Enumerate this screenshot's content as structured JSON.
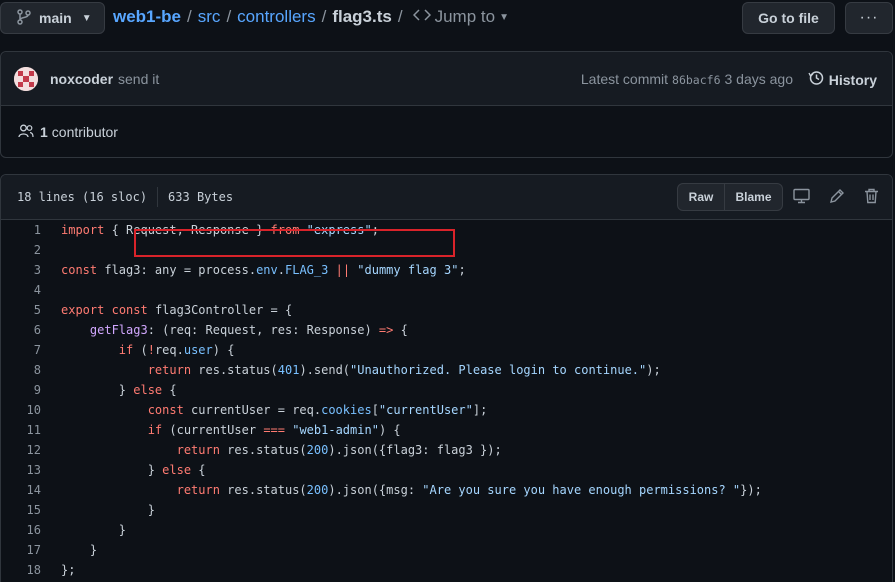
{
  "topbar": {
    "branch": "main",
    "breadcrumbs": [
      {
        "label": "web1-be"
      },
      {
        "label": "src"
      },
      {
        "label": "controllers"
      }
    ],
    "filename": "flag3.ts",
    "jump_to": "Jump to",
    "goto_file": "Go to file",
    "more": "···"
  },
  "commit": {
    "author": "noxcoder",
    "message": "send it",
    "latest_label": "Latest commit",
    "sha": "86bacf6",
    "time": "3 days ago",
    "history": "History"
  },
  "contributors": {
    "count": "1",
    "label": "contributor"
  },
  "file": {
    "lines_info": "18 lines (16 sloc)",
    "size": "633 Bytes",
    "raw": "Raw",
    "blame": "Blame"
  },
  "code_lines": [
    "import { Request, Response } from \"express\";",
    "",
    "const flag3: any = process.env.FLAG_3 || \"dummy flag 3\";",
    "",
    "export const flag3Controller = {",
    "    getFlag3: (req: Request, res: Response) => {",
    "        if (!req.user) {",
    "            return res.status(401).send(\"Unauthorized. Please login to continue.\");",
    "        } else {",
    "            const currentUser = req.cookies[\"currentUser\"];",
    "            if (currentUser === \"web1-admin\") {",
    "                return res.status(200).json({flag3: flag3 });",
    "            } else {",
    "                return res.status(200).json({msg: \"Are you sure you have enough permissions? \"});",
    "            }",
    "        }",
    "    }",
    "};"
  ],
  "colors": {
    "background": "#0d1117",
    "link": "#58a6ff",
    "keyword": "#ff7b72",
    "string": "#a5d6ff",
    "highlight_box": "#d9232a"
  }
}
